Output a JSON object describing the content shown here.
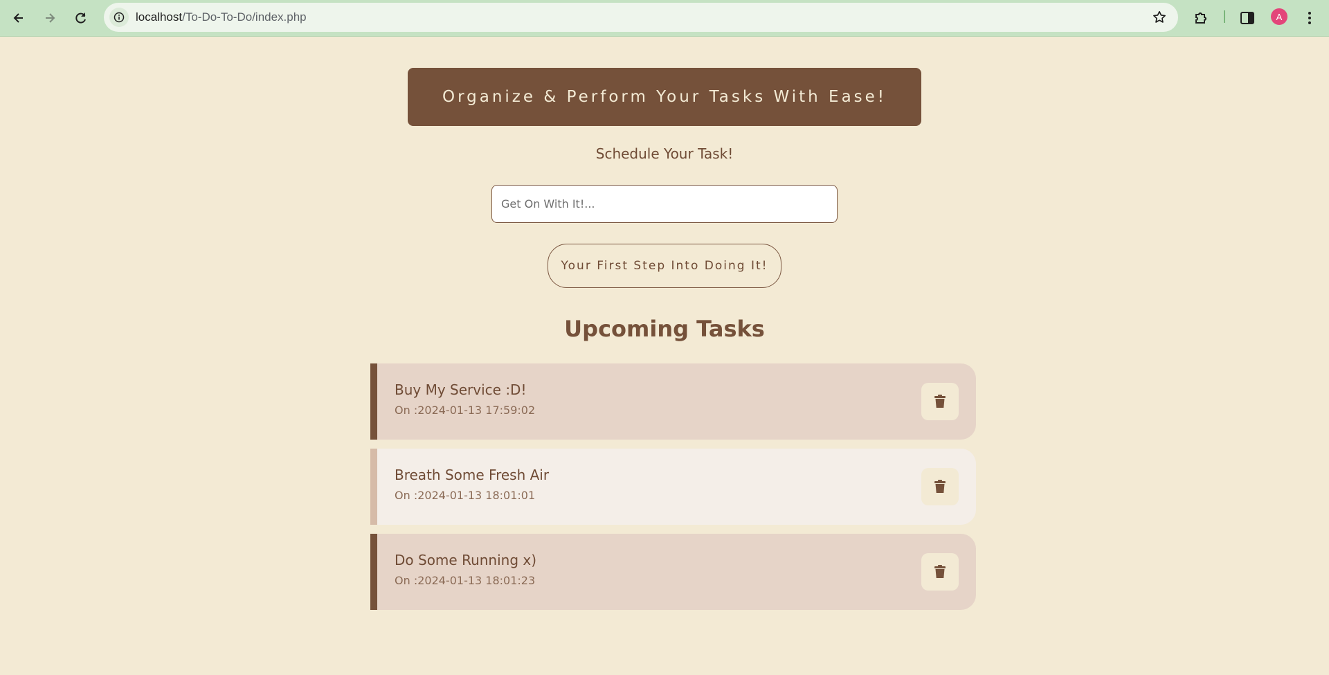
{
  "browser": {
    "url_host": "localhost",
    "url_path": "/To-Do-To-Do/index.php",
    "avatar_letter": "A"
  },
  "icons": {
    "back": "back-arrow-icon",
    "forward": "forward-arrow-icon",
    "reload": "reload-icon",
    "site_info": "info-icon",
    "bookmark": "star-icon",
    "extensions": "puzzle-icon",
    "side_panel": "side-panel-icon",
    "menu": "kebab-menu-icon",
    "delete": "trash-icon"
  },
  "header": {
    "banner": "Organize & Perform Your Tasks With Ease!",
    "subtitle": "Schedule Your Task!"
  },
  "form": {
    "placeholder": "Get On With It!...",
    "submit_label": "Your First Step Into Doing It!"
  },
  "tasks_section": {
    "title": "Upcoming Tasks",
    "items": [
      {
        "title": "Buy My Service :D!",
        "date": "On :2024-01-13 17:59:02"
      },
      {
        "title": "Breath Some Fresh Air",
        "date": "On :2024-01-13 18:01:01"
      },
      {
        "title": "Do Some Running x)",
        "date": "On :2024-01-13 18:01:23"
      }
    ]
  },
  "colors": {
    "background": "#f3ead4",
    "accent_brown": "#75513a",
    "task_dark_bg": "#e6d4c8",
    "task_light_bg": "#f4eee8",
    "chrome_green": "#c5e2c3"
  }
}
